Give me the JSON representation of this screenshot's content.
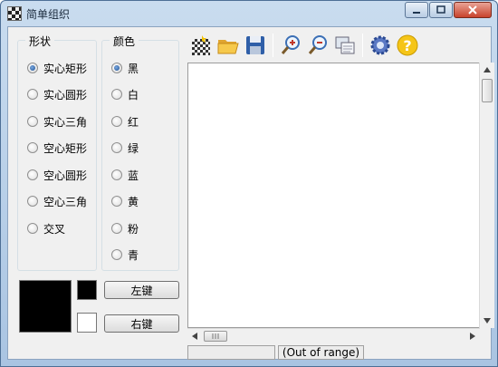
{
  "window": {
    "title": "简单组织"
  },
  "shape_group": {
    "title": "形状",
    "options": [
      "实心矩形",
      "实心圆形",
      "实心三角",
      "空心矩形",
      "空心圆形",
      "空心三角",
      "交叉"
    ],
    "selected": "实心矩形"
  },
  "color_group": {
    "title": "颜色",
    "options": [
      "黑",
      "白",
      "红",
      "绿",
      "蓝",
      "黄",
      "粉",
      "青"
    ],
    "selected": "黑"
  },
  "colors": {
    "preview": "#000000",
    "left_swatch": "#000000",
    "right_swatch": "#ffffff",
    "accent": "#1d4f91"
  },
  "buttons": {
    "left": "左键",
    "right": "右键"
  },
  "toolbar": {
    "icons": [
      "checker-icon",
      "folder-open-icon",
      "save-icon",
      "zoom-in-icon",
      "zoom-out-icon",
      "windows-icon",
      "gear-icon",
      "help-icon"
    ]
  },
  "status": {
    "text": "(Out of range)"
  }
}
